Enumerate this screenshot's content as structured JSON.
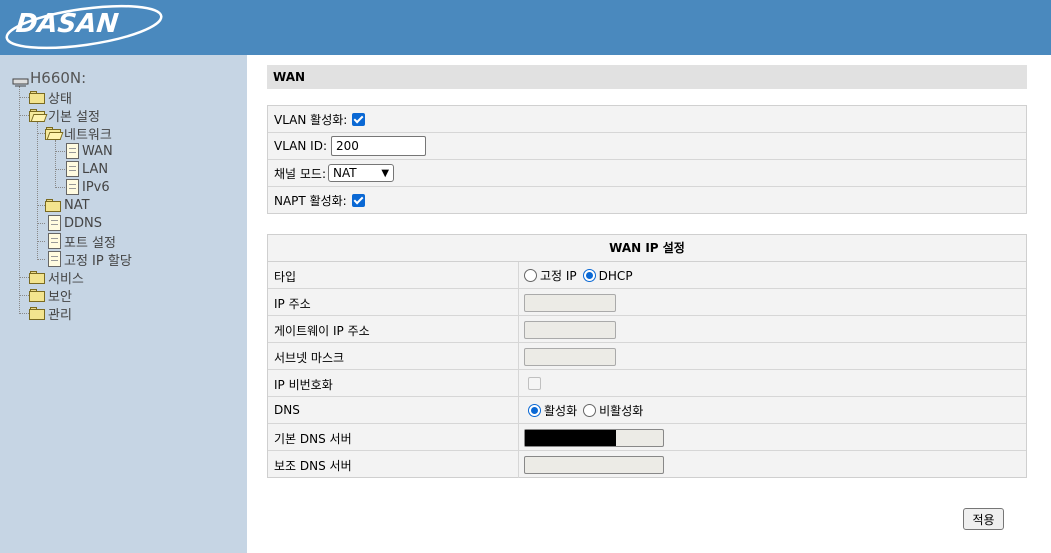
{
  "header": {
    "logo_text": "DASAN"
  },
  "sidebar": {
    "root": "H660N:",
    "items": [
      {
        "label": "상태"
      },
      {
        "label": "기본 설정"
      },
      {
        "label": "네트워크"
      },
      {
        "label": "WAN"
      },
      {
        "label": "LAN"
      },
      {
        "label": "IPv6"
      },
      {
        "label": "NAT"
      },
      {
        "label": "DDNS"
      },
      {
        "label": "포트 설정"
      },
      {
        "label": "고정 IP 할당"
      },
      {
        "label": "서비스"
      },
      {
        "label": "보안"
      },
      {
        "label": "관리"
      }
    ]
  },
  "main": {
    "title": "WAN",
    "vlan": {
      "enable_label": "VLAN 활성화:",
      "enable_checked": true,
      "id_label": "VLAN ID:",
      "id_value": "200",
      "channel_mode_label": "채널 모드:",
      "channel_mode_value": "NAT",
      "napt_label": "NAPT 활성화:",
      "napt_checked": true
    },
    "wan_ip": {
      "heading": "WAN IP 설정",
      "type_label": "타입",
      "type_options": [
        "고정 IP",
        "DHCP"
      ],
      "type_selected": "DHCP",
      "ip_label": "IP 주소",
      "gateway_label": "게이트웨이 IP 주소",
      "subnet_label": "서브넷 마스크",
      "unnumbered_label": "IP 비번호화",
      "dns_label": "DNS",
      "dns_options": [
        "활성화",
        "비활성화"
      ],
      "dns_selected": "활성화",
      "primary_dns_label": "기본 DNS 서버",
      "secondary_dns_label": "보조 DNS 서버"
    },
    "apply_label": "적용"
  },
  "colors": {
    "header": "#4a89be",
    "sidebar": "#c6d5e4",
    "accent": "#0a68d4"
  }
}
